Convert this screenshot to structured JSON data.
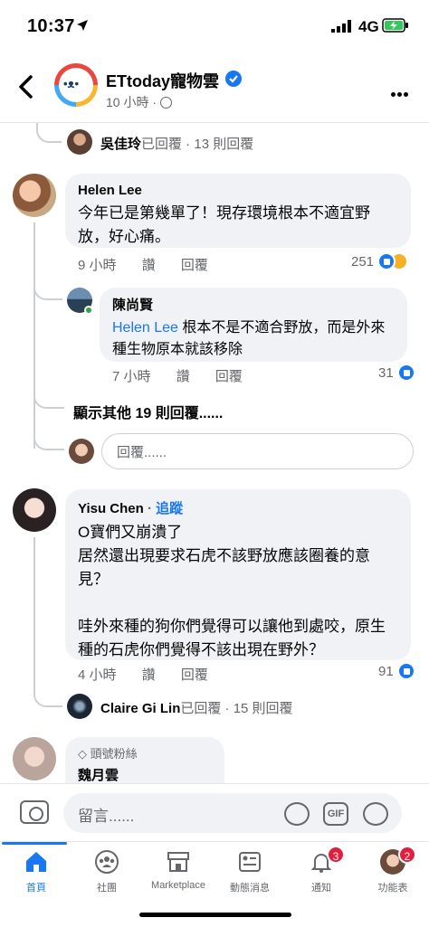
{
  "status_bar": {
    "time": "10:37",
    "network": "4G"
  },
  "header": {
    "page_name": "ETtoday寵物雲",
    "meta": "10 小時 ·"
  },
  "thread": {
    "wu_summary": {
      "name": "吳佳玲",
      "text": "已回覆 · 13 則回覆"
    },
    "helen": {
      "name": "Helen Lee",
      "text": "今年已是第幾單了！現存環境根本不適宜野放，好心痛。",
      "time": "9 小時",
      "like": "讚",
      "reply": "回覆",
      "count": "251"
    },
    "chen": {
      "name": "陳尚賢",
      "mention": "Helen Lee",
      "text": " 根本不是不適合野放，而是外來種生物原本就該移除",
      "time": "7 小時",
      "like": "讚",
      "reply": "回覆",
      "count": "31"
    },
    "show_more": "顯示其他 19 則回覆......",
    "reply_placeholder": "回覆......",
    "yisu": {
      "name": "Yisu Chen",
      "follow": "追蹤",
      "line1": "O寶們又崩潰了",
      "line2": "居然還出現要求石虎不該野放應該圈養的意見？",
      "line3": "哇外來種的狗你們覺得可以讓他到處咬，原生種的石虎你們覺得不該出現在野外？",
      "time": "4 小時",
      "like": "讚",
      "reply": "回覆",
      "count": "91"
    },
    "claire_summary": {
      "name": "Claire Gi Lin",
      "text": "已回覆 · 15 則回覆"
    },
    "wei": {
      "badge": "頭號粉絲",
      "name": "魏月雲"
    }
  },
  "composer": {
    "placeholder": "留言......",
    "gif": "GIF"
  },
  "tabs": [
    {
      "label": "首頁"
    },
    {
      "label": "社團"
    },
    {
      "label": "Marketplace"
    },
    {
      "label": "動態消息"
    },
    {
      "label": "通知",
      "badge": "3"
    },
    {
      "label": "功能表",
      "badge": "2"
    }
  ],
  "colors": {
    "accent": "#1877f2",
    "bubble": "#f0f2f5",
    "badge": "#e41e3f"
  }
}
